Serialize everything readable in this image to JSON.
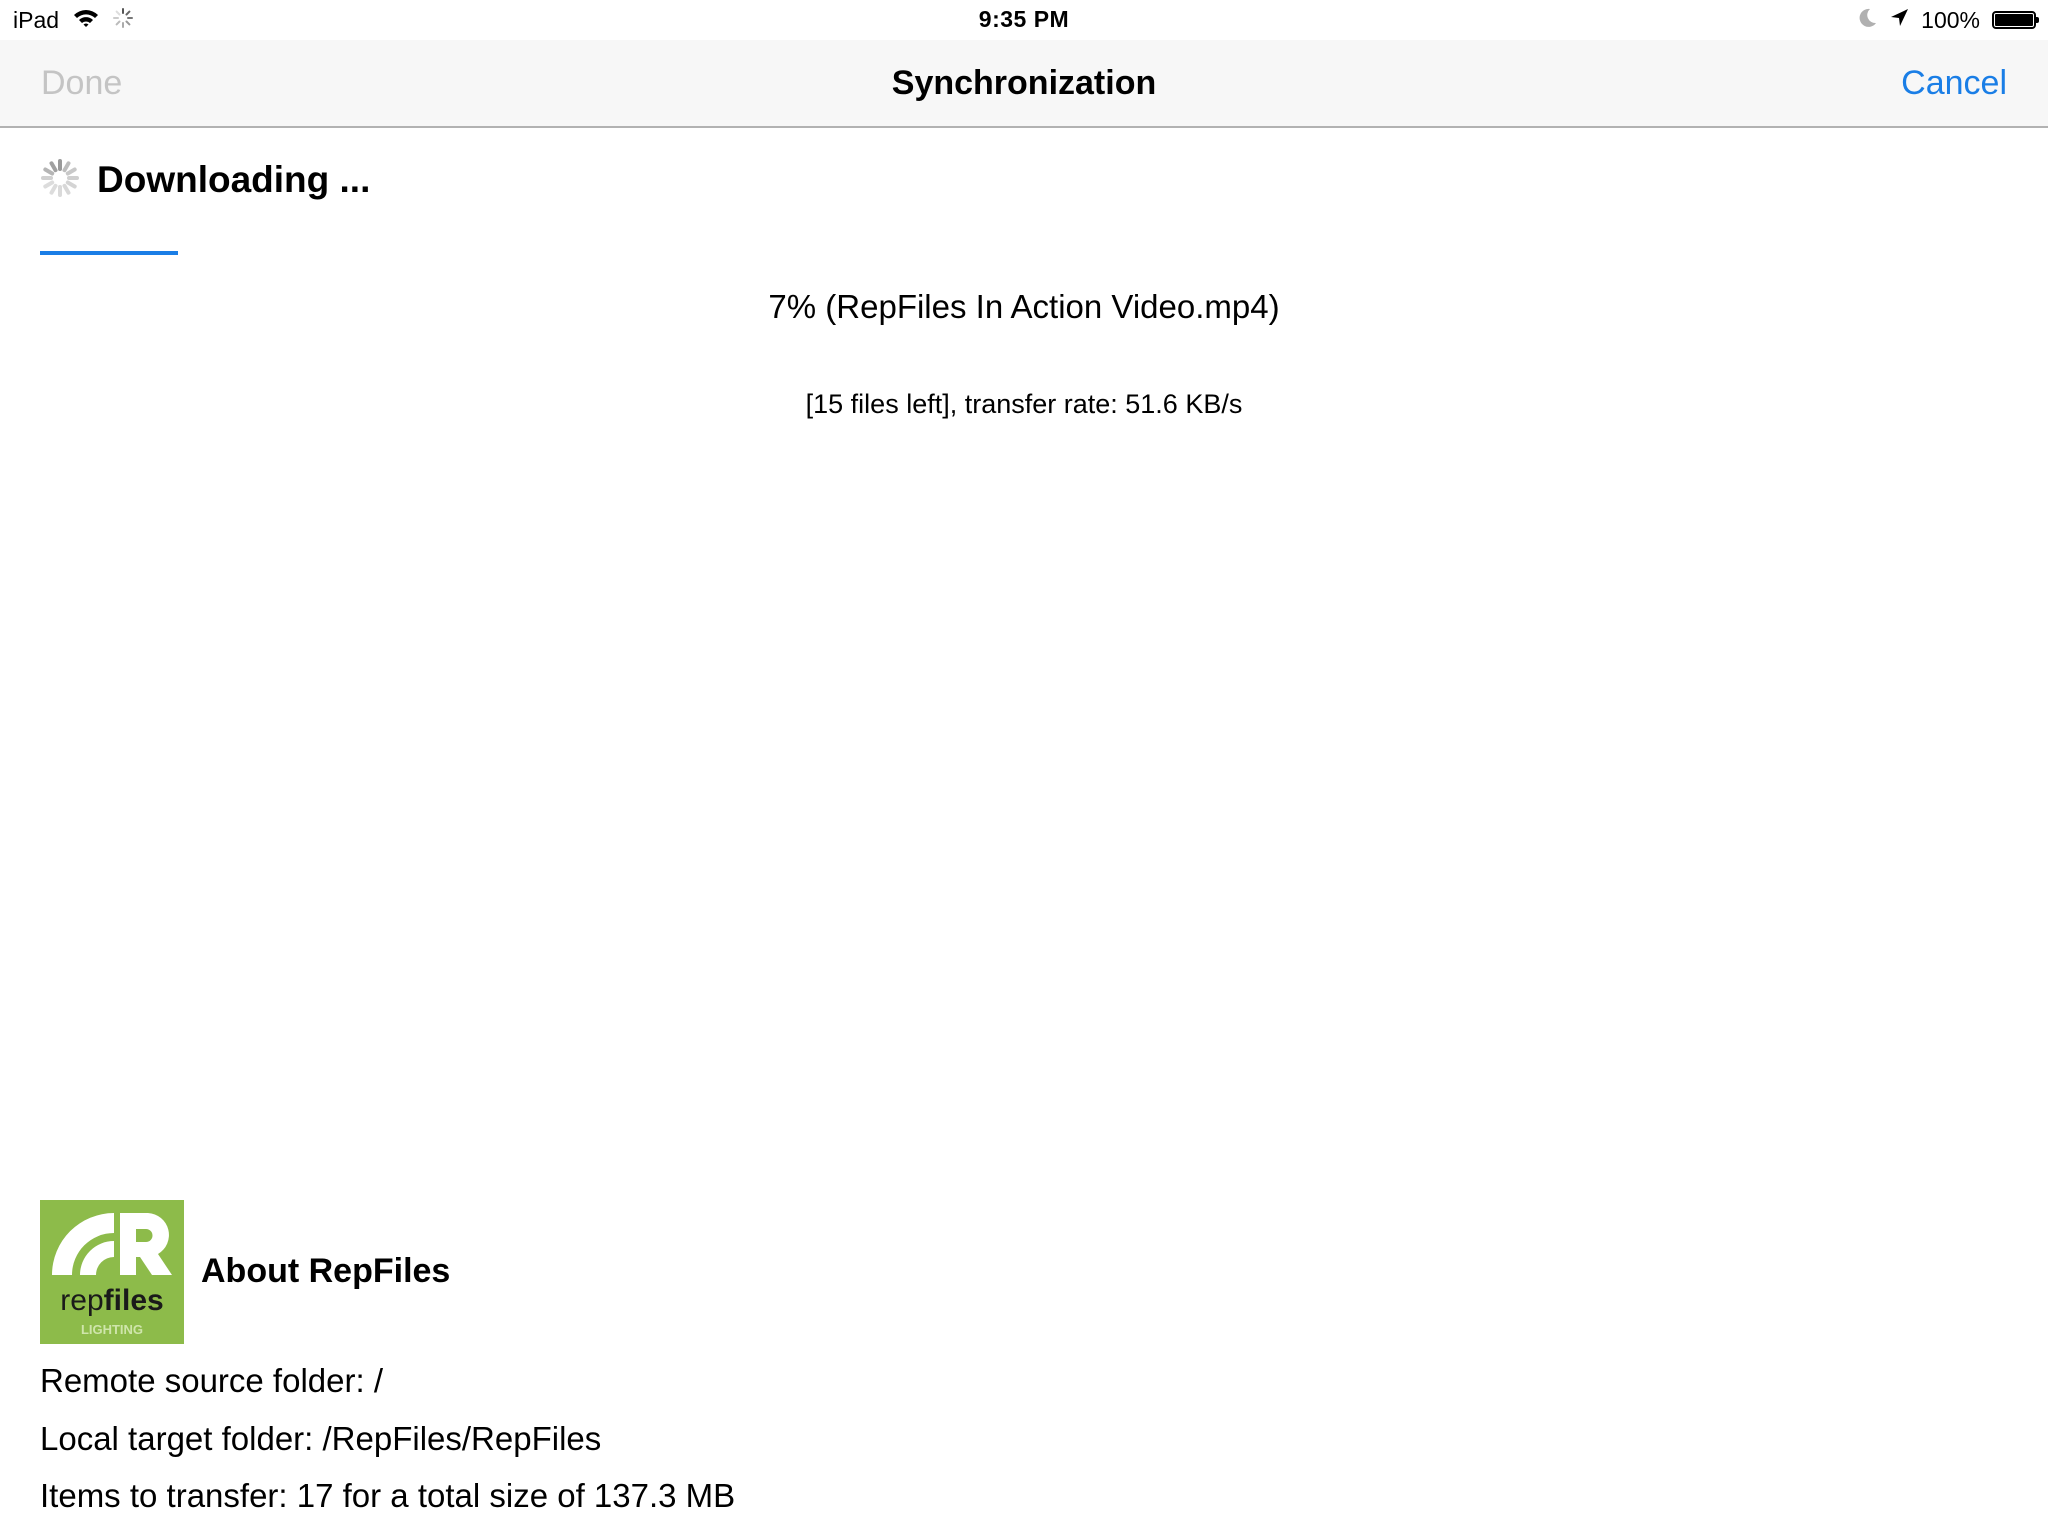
{
  "status_bar": {
    "device": "iPad",
    "time": "9:35 PM",
    "battery": "100%",
    "icons": [
      "wifi-icon",
      "activity-spinner-icon",
      "do-not-disturb-moon-icon",
      "location-arrow-icon",
      "battery-icon"
    ]
  },
  "nav": {
    "done_label": "Done",
    "title": "Synchronization",
    "cancel_label": "Cancel"
  },
  "sync": {
    "status": "Downloading ...",
    "progress_percent": 7,
    "progress_text": "7% (RepFiles In Action Video.mp4)",
    "files_text": "[15 files left], transfer rate: 51.6 KB/s"
  },
  "about": {
    "title": "About RepFiles",
    "logo": {
      "word_light": "rep",
      "word_bold": "files",
      "subtitle": "LIGHTING"
    },
    "lines": [
      "Remote source folder: /",
      "Local target folder: /RepFiles/RepFiles",
      "Items to transfer: 17 for a total size of 137.3 MB"
    ]
  },
  "colors": {
    "accent": "#1a7ee6",
    "disabled": "#c4c4c4",
    "logo_green": "#8dbb4a"
  }
}
